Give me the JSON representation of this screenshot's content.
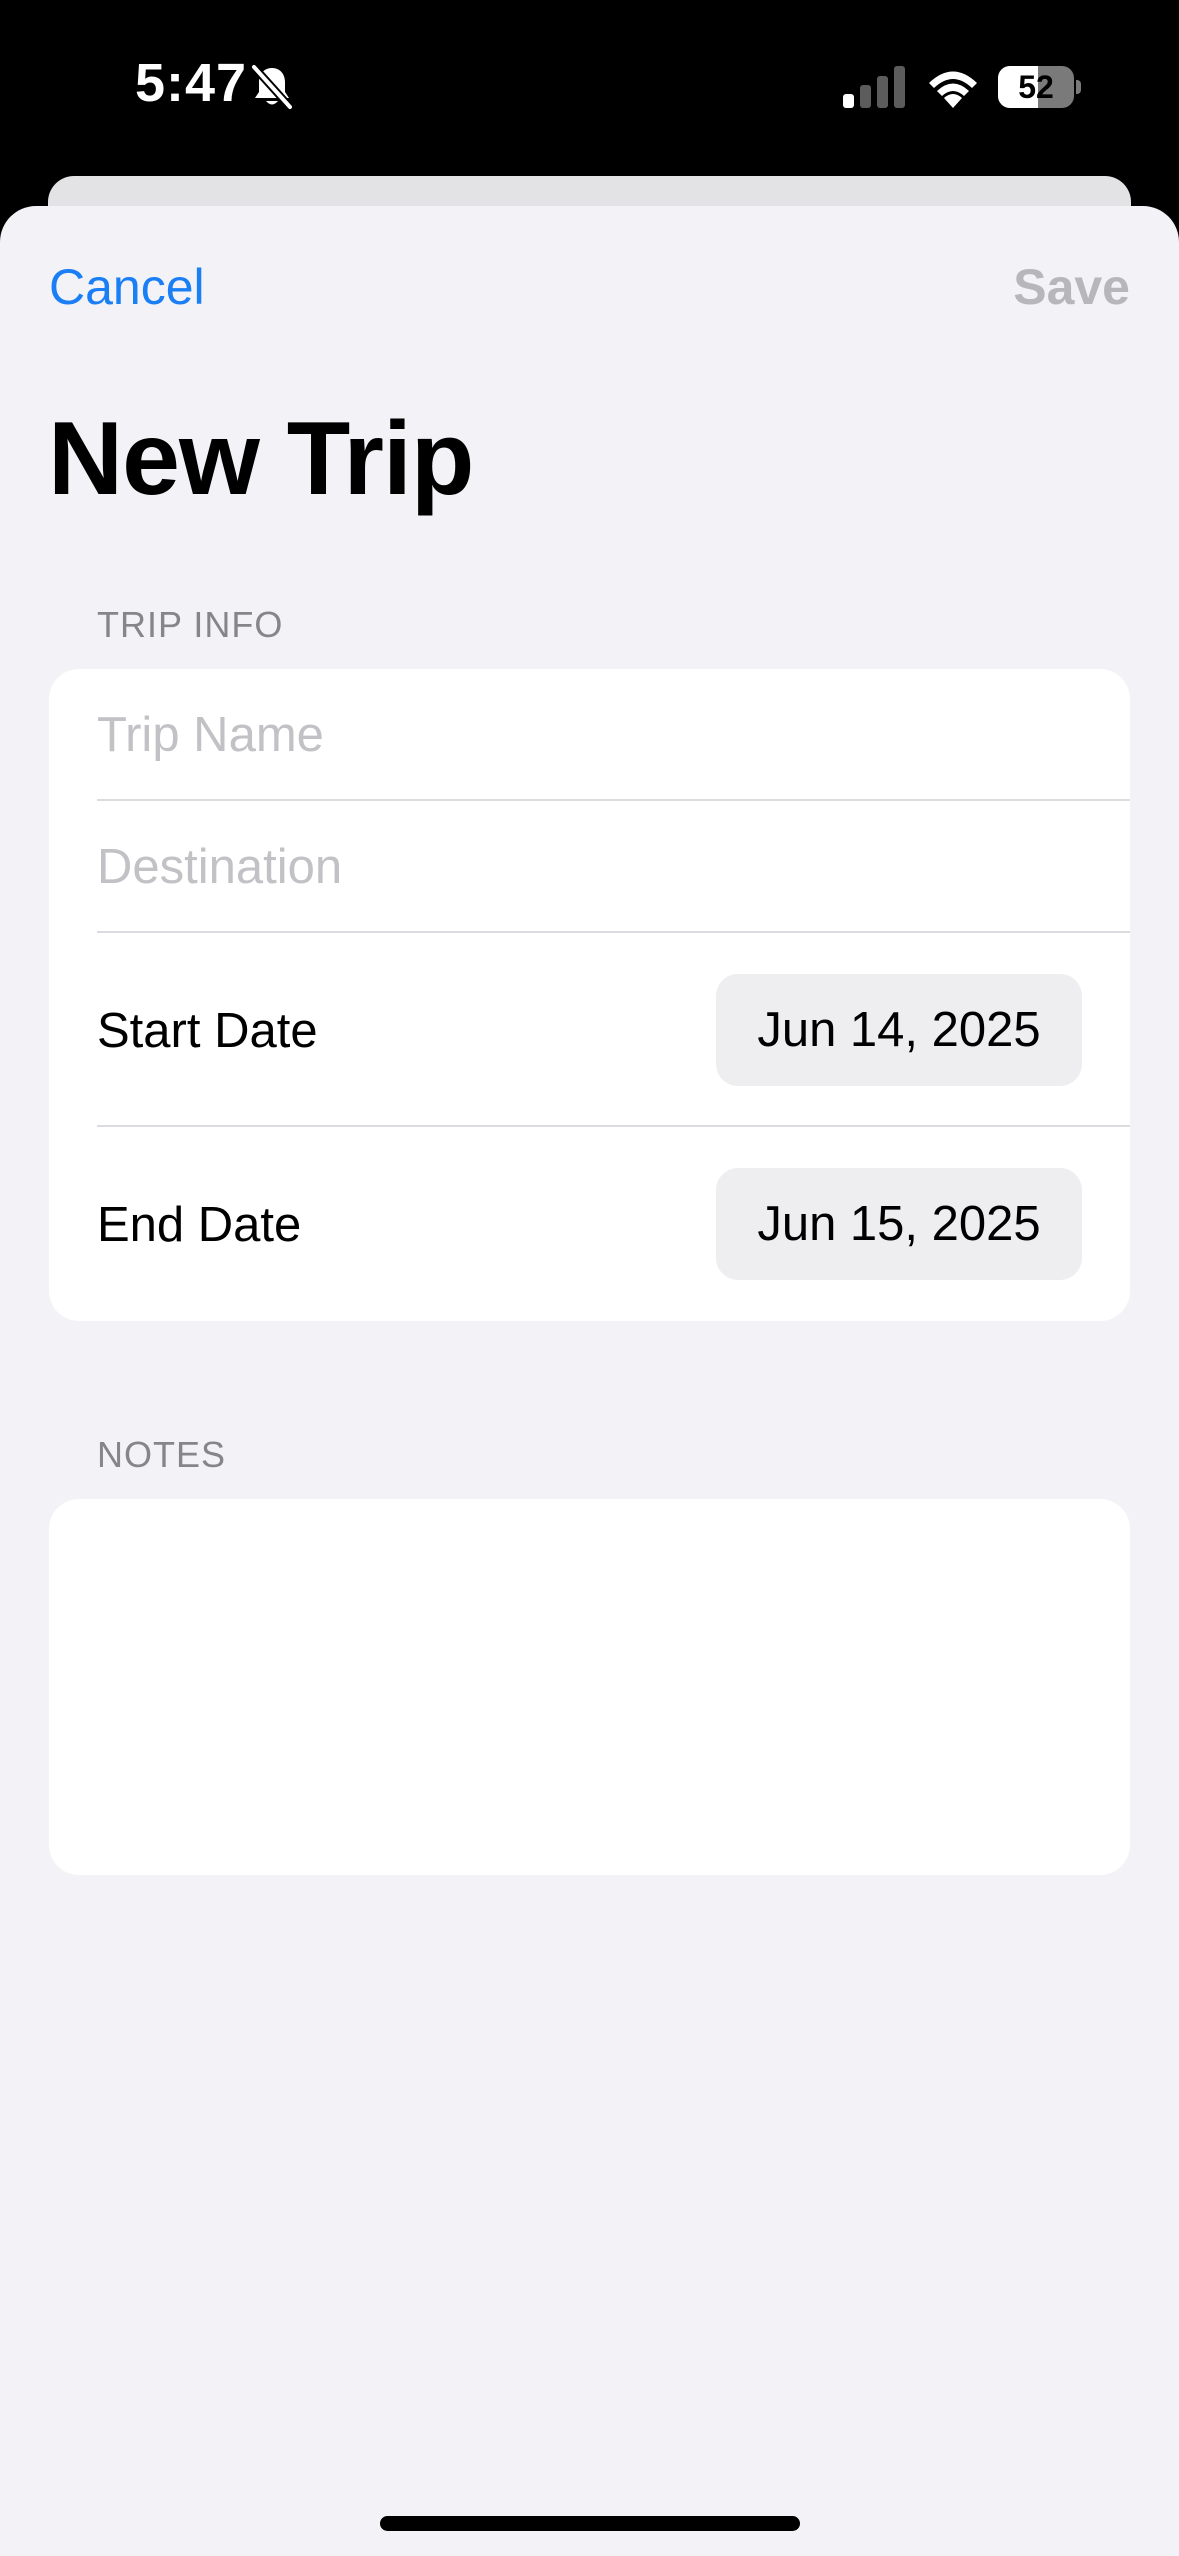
{
  "status_bar": {
    "time": "5:47",
    "battery_level": "52",
    "battery_fraction": 0.52,
    "icons": [
      "bell-slash-icon",
      "cellular-signal-icon",
      "wifi-icon",
      "battery-icon"
    ]
  },
  "nav": {
    "cancel_label": "Cancel",
    "save_label": "Save"
  },
  "page": {
    "title": "New Trip"
  },
  "trip_info": {
    "header": "TRIP INFO",
    "trip_name_placeholder": "Trip Name",
    "destination_placeholder": "Destination",
    "start_date_label": "Start Date",
    "start_date_value": "Jun 14, 2025",
    "end_date_label": "End Date",
    "end_date_value": "Jun 15, 2025"
  },
  "notes": {
    "header": "NOTES"
  },
  "colors": {
    "accent": "#1a7ef5",
    "disabled": "#b6b6bb",
    "background": "#f2f2f7",
    "card": "#ffffff"
  }
}
